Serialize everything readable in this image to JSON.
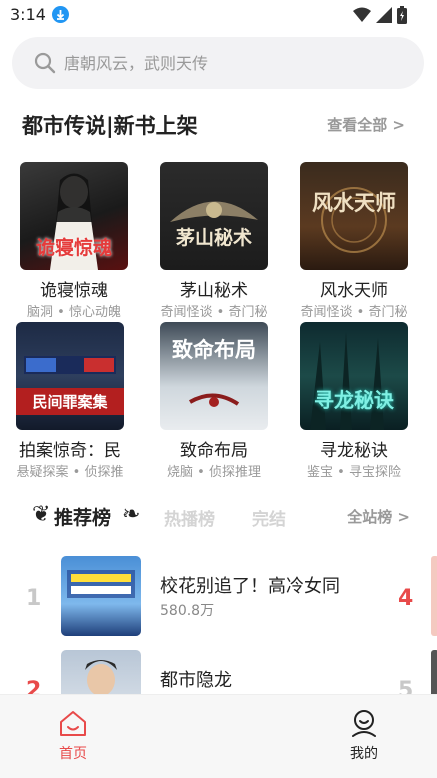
{
  "status_bar": {
    "time": "3:14",
    "icons": [
      "download-icon",
      "wifi-icon",
      "signal-icon",
      "battery-icon"
    ]
  },
  "search": {
    "placeholder": "唐朝风云，武则天传"
  },
  "section": {
    "title": "都市传说|新书上架",
    "see_all": "查看全部 >"
  },
  "books": [
    {
      "title": "诡寝惊魂",
      "tags": "脑洞 • 惊心动魄",
      "cover_text": "诡寝惊魂"
    },
    {
      "title": "茅山秘术",
      "tags": "奇闻怪谈 • 奇门秘",
      "cover_text": "茅山秘术"
    },
    {
      "title": "风水天师",
      "tags": "奇闻怪谈 • 奇门秘",
      "cover_text": "风水天师"
    },
    {
      "title": "拍案惊奇：民",
      "tags": "悬疑探案 • 侦探推",
      "cover_text": "民间罪案集"
    },
    {
      "title": "致命布局",
      "tags": "烧脑 • 侦探推理",
      "cover_text": "致命布局"
    },
    {
      "title": "寻龙秘诀",
      "tags": "鉴宝 • 寻宝探险",
      "cover_text": "寻龙秘诀"
    }
  ],
  "ranking": {
    "tabs": [
      "推荐榜",
      "热播榜",
      "完结"
    ],
    "active_tab": "推荐榜",
    "all_label": "全站榜 >",
    "items": [
      {
        "rank": "1",
        "title": "校花别追了！高冷女同",
        "count": "580.8万",
        "side_rank": "4",
        "side_color": "#e84a4a"
      },
      {
        "rank": "2",
        "title": "都市隐龙",
        "count": "",
        "side_rank": "5",
        "side_color": "#c8c8c8"
      }
    ]
  },
  "bottom_nav": {
    "items": [
      {
        "label": "首页",
        "icon": "home-icon",
        "active": true
      },
      {
        "label": "我的",
        "icon": "profile-icon",
        "active": false
      }
    ],
    "active_color": "#e84a4a"
  }
}
